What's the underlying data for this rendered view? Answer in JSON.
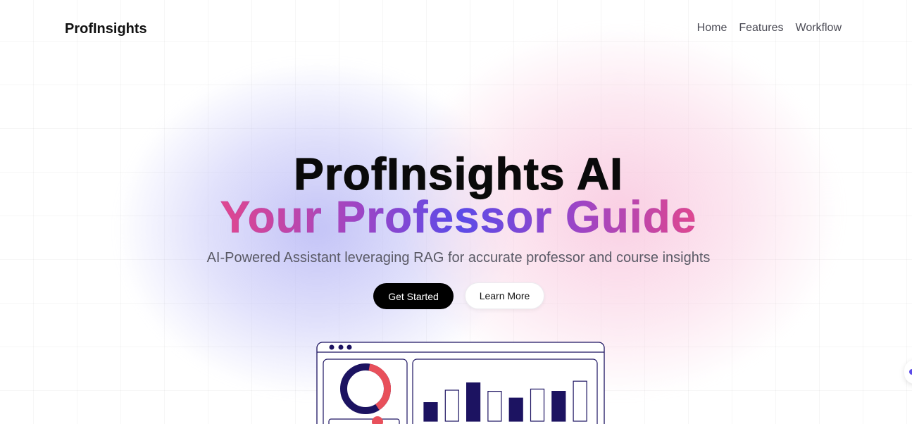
{
  "nav": {
    "brand": "ProfInsights",
    "links": [
      "Home",
      "Features",
      "Workflow"
    ]
  },
  "hero": {
    "title": "ProfInsights AI",
    "subtitle": "Your Professor Guide",
    "tagline": "AI-Powered Assistant leveraging RAG for accurate professor and course insights",
    "primary_cta": "Get Started",
    "secondary_cta": "Learn More"
  },
  "illustration": {
    "donut": {
      "highlight_fraction": 0.38
    },
    "bars": [
      {
        "value": 0.33,
        "filled": true
      },
      {
        "value": 0.55,
        "filled": false
      },
      {
        "value": 0.68,
        "filled": true
      },
      {
        "value": 0.53,
        "filled": false
      },
      {
        "value": 0.41,
        "filled": true
      },
      {
        "value": 0.57,
        "filled": false
      },
      {
        "value": 0.53,
        "filled": true
      },
      {
        "value": 0.71,
        "filled": false
      }
    ]
  },
  "colors": {
    "primary_dark": "#1c1361",
    "accent_red": "#e8505b",
    "gradient_pink": "#e0478f",
    "gradient_blue": "#5b4be8"
  }
}
